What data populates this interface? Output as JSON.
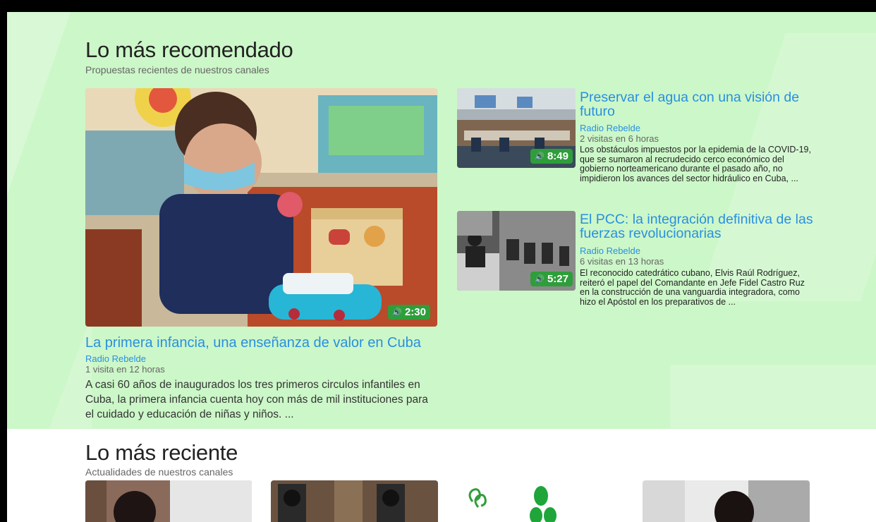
{
  "recommended": {
    "title": "Lo más recomendado",
    "subtitle": "Propuestas recientes de nuestros canales",
    "featured": {
      "duration": "2:30",
      "title": "La primera infancia, una enseñanza de valor en Cuba",
      "source": "Radio Rebelde",
      "visits": "1 visita en 12 horas",
      "description": "A casi 60 años de inaugurados los tres primeros circulos infantiles en Cuba, la primera infancia cuenta hoy con más de mil instituciones para el cuidado y educación de niñas y niños. ..."
    },
    "items": [
      {
        "duration": "8:49",
        "title": "Preservar el agua con una visión de futuro",
        "source": "Radio Rebelde",
        "visits": "2 visitas en 6 horas",
        "description": "Los obstáculos impuestos por la epidemia de la COVID-19, que se sumaron al recrudecido cerco económico del gobierno norteamericano durante el pasado año, no impidieron los avances del sector hidráulico en Cuba, ..."
      },
      {
        "duration": "5:27",
        "title": "El PCC: la integración definitiva de las fuerzas revolucionarias",
        "source": "Radio Rebelde",
        "visits": "6 visitas en 13 horas",
        "description": "El reconocido catedrático cubano, Elvis Raúl Rodríguez, reiteró el papel del Comandante en Jefe Fidel Castro Ruz en la construcción de una vanguardia integradora, como hizo el Apóstol en los preparativos de ..."
      }
    ]
  },
  "recent": {
    "title": "Lo más reciente",
    "subtitle": "Actualidades de nuestros canales"
  },
  "colors": {
    "link": "#2a8fe0",
    "badge": "#2e9e3a",
    "section_bg": "#ccf7c8"
  }
}
